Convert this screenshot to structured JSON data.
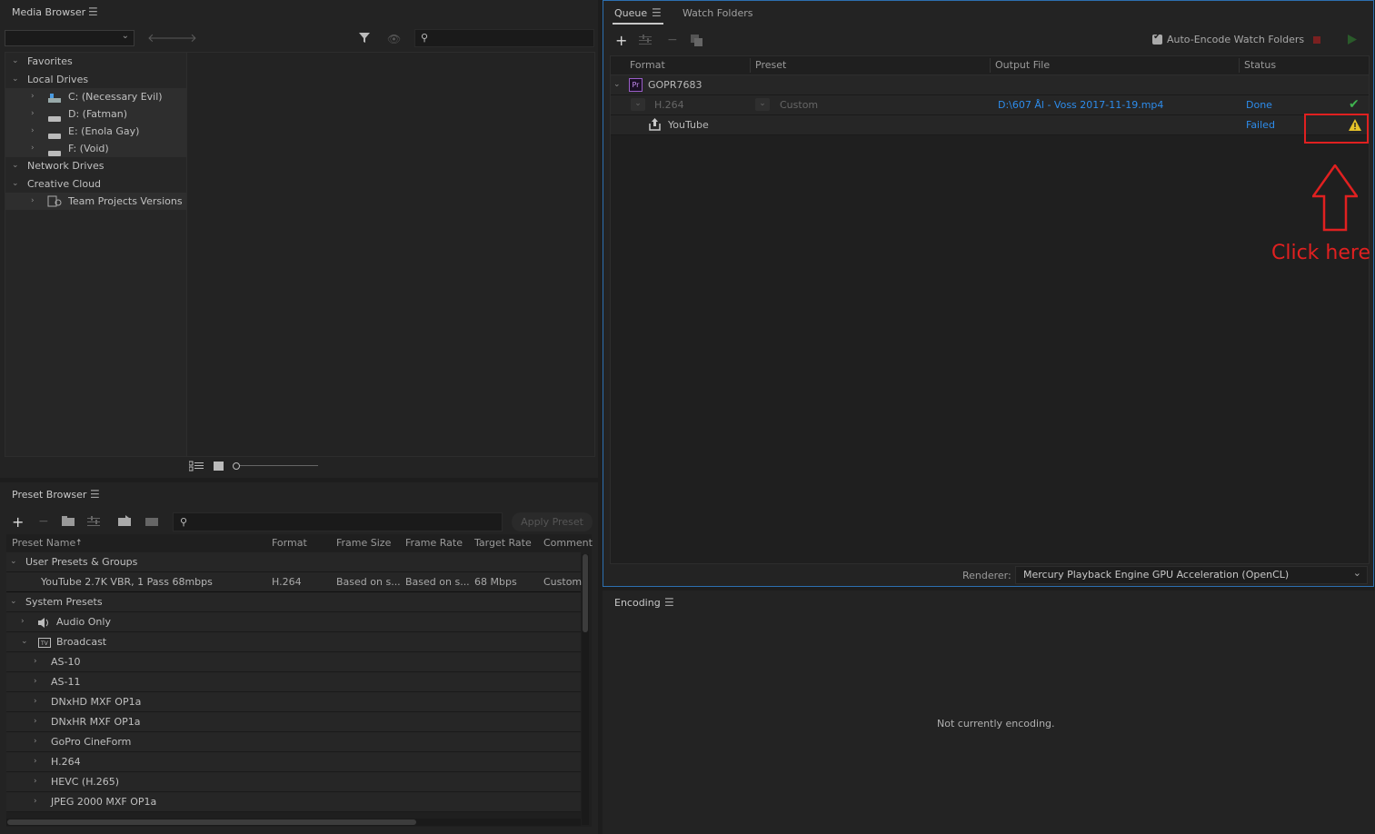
{
  "colors": {
    "accent": "#2d8ceb",
    "success": "#3fb34f",
    "warning": "#e6c229",
    "annotation": "#e02020",
    "selection": "#3a3a3a"
  },
  "media_browser": {
    "title": "Media Browser",
    "search_placeholder": "",
    "tree": [
      {
        "label": "Favorites",
        "level": 0,
        "expanded": true
      },
      {
        "label": "Local Drives",
        "level": 0,
        "expanded": true
      },
      {
        "label": "C: (Necessary Evil)",
        "level": 1,
        "icon": "drive-system-icon"
      },
      {
        "label": "D: (Fatman)",
        "level": 1,
        "icon": "drive-icon"
      },
      {
        "label": "E: (Enola Gay)",
        "level": 1,
        "icon": "drive-icon"
      },
      {
        "label": "F: (Void)",
        "level": 1,
        "icon": "drive-icon"
      },
      {
        "label": "Network Drives",
        "level": 0,
        "expanded": true
      },
      {
        "label": "Creative Cloud",
        "level": 0,
        "expanded": true
      },
      {
        "label": "Team Projects Versions",
        "level": 1,
        "icon": "team-projects-icon"
      }
    ]
  },
  "queue": {
    "tabs": [
      "Queue",
      "Watch Folders"
    ],
    "auto_encode_label": "Auto-Encode Watch Folders",
    "columns": [
      "Format",
      "Preset",
      "Output File",
      "Status"
    ],
    "source": "GOPR7683",
    "source_badge": "Pr",
    "item": {
      "format": "H.264",
      "preset": "Custom",
      "output": "D:\\607 Ål - Voss 2017-11-19.mp4",
      "status": "Done"
    },
    "publish": {
      "name": "YouTube",
      "status": "Failed"
    },
    "renderer_label": "Renderer:",
    "renderer_value": "Mercury Playback Engine GPU Acceleration (OpenCL)"
  },
  "annotation": {
    "text": "Click here"
  },
  "preset_browser": {
    "title": "Preset Browser",
    "apply_label": "Apply Preset",
    "columns": [
      "Preset Name",
      "Format",
      "Frame Size",
      "Frame Rate",
      "Target Rate",
      "Comment"
    ],
    "user_group": "User Presets & Groups",
    "user_preset": {
      "name": "YouTube 2.7K VBR, 1 Pass 68mbps",
      "format": "H.264",
      "frame_size": "Based on s...",
      "frame_rate": "Based on s...",
      "target_rate": "68 Mbps",
      "comment": "Custom"
    },
    "system_group": "System Presets",
    "categories": [
      {
        "label": "Audio Only",
        "level": 1,
        "icon": "speaker-icon"
      },
      {
        "label": "Broadcast",
        "level": 1,
        "icon": "tv-icon",
        "expanded": true
      },
      {
        "label": "AS-10",
        "level": 2
      },
      {
        "label": "AS-11",
        "level": 2
      },
      {
        "label": "DNxHD MXF OP1a",
        "level": 2
      },
      {
        "label": "DNxHR MXF OP1a",
        "level": 2
      },
      {
        "label": "GoPro CineForm",
        "level": 2
      },
      {
        "label": "H.264",
        "level": 2
      },
      {
        "label": "HEVC (H.265)",
        "level": 2
      },
      {
        "label": "JPEG 2000 MXF OP1a",
        "level": 2
      }
    ]
  },
  "encoding": {
    "title": "Encoding",
    "status": "Not currently encoding."
  }
}
